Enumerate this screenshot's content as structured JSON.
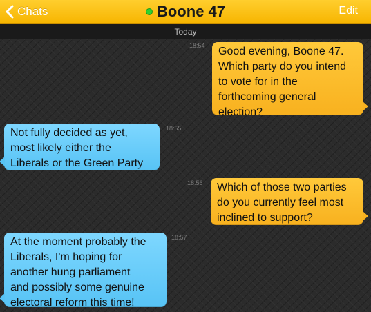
{
  "header": {
    "back_label": "Chats",
    "title": "Boone 47",
    "edit_label": "Edit",
    "online_color": "#2fd12f"
  },
  "date_separator": "Today",
  "messages": [
    {
      "direction": "out",
      "time": "18:54",
      "text": "Good evening, Boone 47.\nWhich party do you intend\nto vote for in the\nforthcoming general\nelection?"
    },
    {
      "direction": "in",
      "time": "18:55",
      "text": "Not fully decided as yet,\nmost likely either the\nLiberals or the Green Party"
    },
    {
      "direction": "out",
      "time": "18:56",
      "text": "Which of those two parties\ndo you currently feel most\ninclined to support?"
    },
    {
      "direction": "in",
      "time": "18:57",
      "text": "At the moment probably the\nLiberals, I'm hoping for\nanother hung parliament\nand possibly some genuine\nelectoral reform this time!"
    }
  ]
}
